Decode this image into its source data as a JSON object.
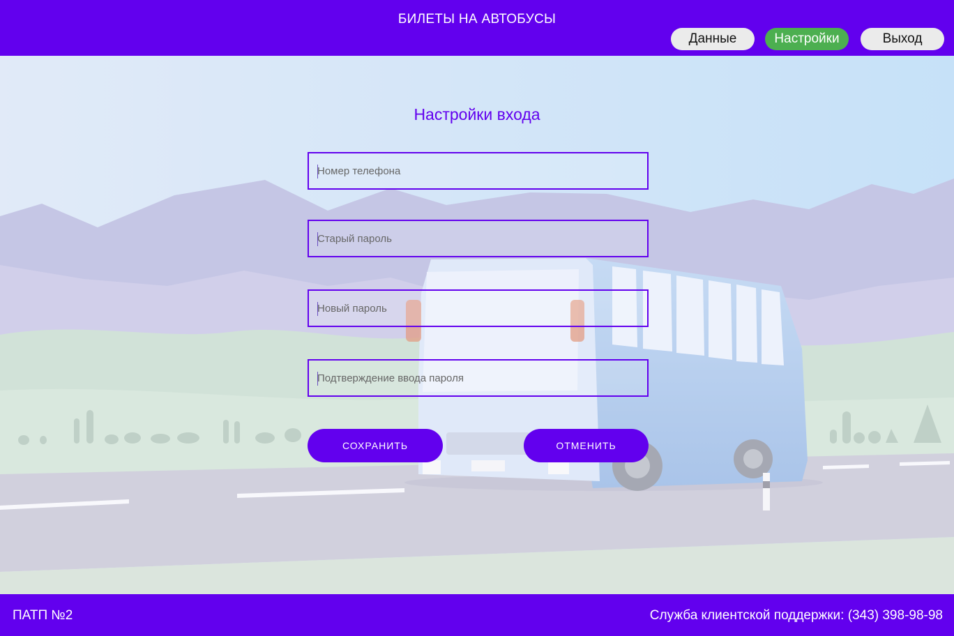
{
  "header": {
    "title": "БИЛЕТЫ НА АВТОБУСЫ",
    "nav": {
      "data_label": "Данные",
      "settings_label": "Настройки",
      "logout_label": "Выход"
    },
    "active_tab": "settings"
  },
  "form": {
    "title": "Настройки входа",
    "fields": [
      {
        "placeholder": "Номер телефона",
        "value": ""
      },
      {
        "placeholder": "Старый пароль",
        "value": ""
      },
      {
        "placeholder": "Новый пароль",
        "value": ""
      },
      {
        "placeholder": "Подтверждение ввода пароля",
        "value": ""
      }
    ],
    "save_label": "СОХРАНИТЬ",
    "cancel_label": "ОТМЕНИТЬ"
  },
  "footer": {
    "company": "ПАТП №2",
    "support": "Служба клиентской поддержки: (343) 398-98-98"
  },
  "colors": {
    "primary": "#6200ee",
    "active_tab": "#4caf50",
    "nav_button": "#ebebeb"
  },
  "background": {
    "image": "bus-on-road-illustration"
  }
}
